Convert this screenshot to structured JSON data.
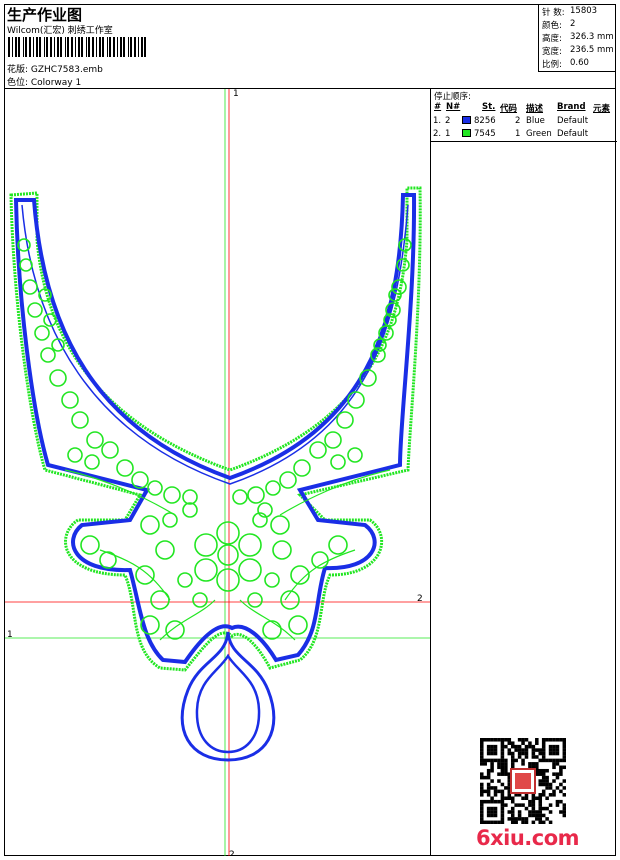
{
  "header": {
    "title": "生产作业图",
    "studio": "Wilcom(汇宏) 刺绣工作室",
    "file": "花版:  GZHC7583.emb",
    "colorway": "色位:  Colorway 1"
  },
  "stats": [
    {
      "label": "针 数:",
      "value": "15803"
    },
    {
      "label": "颜色:",
      "value": "2"
    },
    {
      "label": "高度:",
      "value": "326.3 mm"
    },
    {
      "label": "宽度:",
      "value": "236.5 mm"
    },
    {
      "label": "比例:",
      "value": "0.60"
    }
  ],
  "sequence": {
    "title": "停止顺序:",
    "headers": {
      "num": "#",
      "n": "N#",
      "st": "St.",
      "code": "代码",
      "desc": "描述",
      "brand": "Brand",
      "elem": "元素"
    },
    "rows": [
      {
        "num": "1.",
        "n": "2",
        "color": "#1a2ee6",
        "st": "8256",
        "code": "2",
        "desc": "Blue",
        "brand": "Default"
      },
      {
        "num": "2.",
        "n": "1",
        "color": "#22e622",
        "st": "7545",
        "code": "1",
        "desc": "Green",
        "brand": "Default"
      }
    ]
  },
  "axes": {
    "v1": "1",
    "v2": "2",
    "h1": "1",
    "h2": "2"
  },
  "colors": {
    "blue": "#1a2ee6",
    "green": "#22e622",
    "red": "#ff0000"
  },
  "watermark": "6xiu.com"
}
